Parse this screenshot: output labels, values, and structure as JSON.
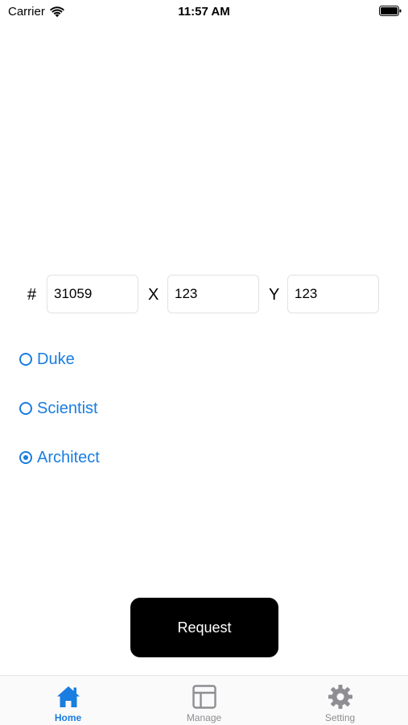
{
  "status_bar": {
    "carrier": "Carrier",
    "time": "11:57 AM"
  },
  "coords": {
    "hash_label": "#",
    "id_value": "31059",
    "x_label": "X",
    "x_value": "123",
    "y_label": "Y",
    "y_value": "123"
  },
  "roles": {
    "options": [
      {
        "label": "Duke",
        "checked": false
      },
      {
        "label": "Scientist",
        "checked": false
      },
      {
        "label": "Architect",
        "checked": true
      }
    ]
  },
  "actions": {
    "request_label": "Request"
  },
  "tab_bar": {
    "tabs": [
      {
        "label": "Home",
        "icon": "house-icon",
        "active": true
      },
      {
        "label": "Manage",
        "icon": "layout-icon",
        "active": false
      },
      {
        "label": "Setting",
        "icon": "gear-icon",
        "active": false
      }
    ]
  },
  "colors": {
    "accent": "#1a7de0",
    "inactive": "#8e8e93",
    "button_bg": "#000000"
  }
}
